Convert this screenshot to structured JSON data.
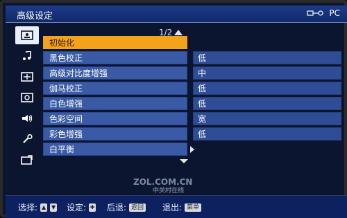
{
  "titlebar": {
    "title": "高级设定",
    "input_source": "PC",
    "input_icon": "input-plug-icon"
  },
  "sidebar": {
    "items": [
      {
        "icon": "picture-icon",
        "active": true
      },
      {
        "icon": "music-note-icon",
        "active": false
      },
      {
        "icon": "screen-adjust-icon",
        "active": false
      },
      {
        "icon": "display-settings-icon",
        "active": false
      },
      {
        "icon": "volume-icon",
        "active": false
      },
      {
        "icon": "wrench-icon",
        "active": false
      },
      {
        "icon": "input-select-icon",
        "active": false
      }
    ]
  },
  "pager": {
    "text": "1/2"
  },
  "menu": {
    "rows": [
      {
        "label": "初始化",
        "value": "",
        "active": true
      },
      {
        "label": "黑色校正",
        "value": "低"
      },
      {
        "label": "高级对比度增强",
        "value": "中"
      },
      {
        "label": "伽马校正",
        "value": "低"
      },
      {
        "label": "白色增强",
        "value": "低"
      },
      {
        "label": "色彩空间",
        "value": "宽"
      },
      {
        "label": "彩色增强",
        "value": "低"
      },
      {
        "label": "白平衡",
        "value": "",
        "has_submenu": true
      }
    ]
  },
  "watermark": {
    "text": "ZOL.COM.CN",
    "subtext": "中关村在线"
  },
  "footer": {
    "select_label": "选择:",
    "select_keys": [
      "▲",
      "▼"
    ],
    "set_label": "设定:",
    "set_key": "✚",
    "back_label": "后退:",
    "back_key": "返回",
    "exit_label": "退出:",
    "exit_key": "菜单"
  },
  "colors": {
    "active_orange": "#f4a11b",
    "row_blue": "#3a5aa6",
    "bg": "#0c1530"
  }
}
